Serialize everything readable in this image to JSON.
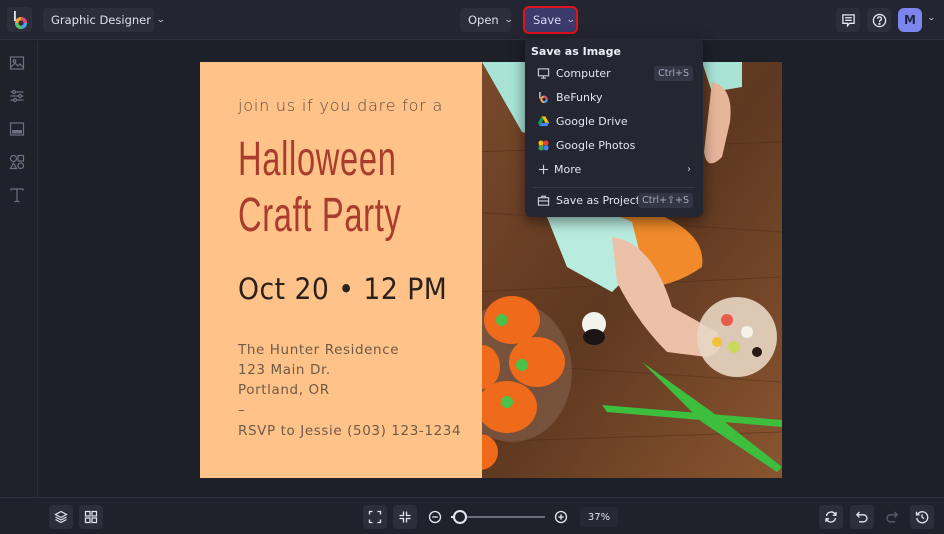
{
  "topbar": {
    "app_mode": "Graphic Designer",
    "open_label": "Open",
    "save_label": "Save",
    "avatar_initial": "M",
    "colors": {
      "save_highlight": "#e0121b",
      "avatar_bg": "#7d85ef",
      "save_bg": "#3b3a6b"
    }
  },
  "sidebar": {
    "items": [
      {
        "icon": "image-icon",
        "label": "Image Manager"
      },
      {
        "icon": "sliders-icon",
        "label": "Edit"
      },
      {
        "icon": "layout-icon",
        "label": "Layouts"
      },
      {
        "icon": "shapes-icon",
        "label": "Graphics"
      },
      {
        "icon": "text-icon",
        "label": "Text"
      }
    ]
  },
  "save_menu": {
    "heading": "Save as Image",
    "items": [
      {
        "icon": "monitor-icon",
        "label": "Computer",
        "shortcut": "Ctrl+S"
      },
      {
        "icon": "befunky-icon",
        "label": "BeFunky"
      },
      {
        "icon": "google-drive-icon",
        "label": "Google Drive"
      },
      {
        "icon": "google-photos-icon",
        "label": "Google Photos"
      },
      {
        "icon": "plus-icon",
        "label": "More",
        "submenu": true
      }
    ],
    "project_item": {
      "icon": "briefcase-icon",
      "label": "Save as Project",
      "shortcut": "Ctrl+⇧+S"
    }
  },
  "design": {
    "subtitle": "join us if you dare for a",
    "title_line1": "Halloween",
    "title_line2": "Craft Party",
    "date": "Oct 20 • 12 PM",
    "address": [
      "The Hunter Residence",
      "123 Main Dr.",
      "Portland, OR",
      "–",
      "RSVP to Jessie (503) 123-1234"
    ],
    "colors": {
      "panel": "#ffc38a",
      "title": "#a93c2d",
      "date": "#2b221c",
      "body": "#6e5a48"
    }
  },
  "bottombar": {
    "zoom_percent": "37%",
    "zoom_fraction": 0.1
  }
}
